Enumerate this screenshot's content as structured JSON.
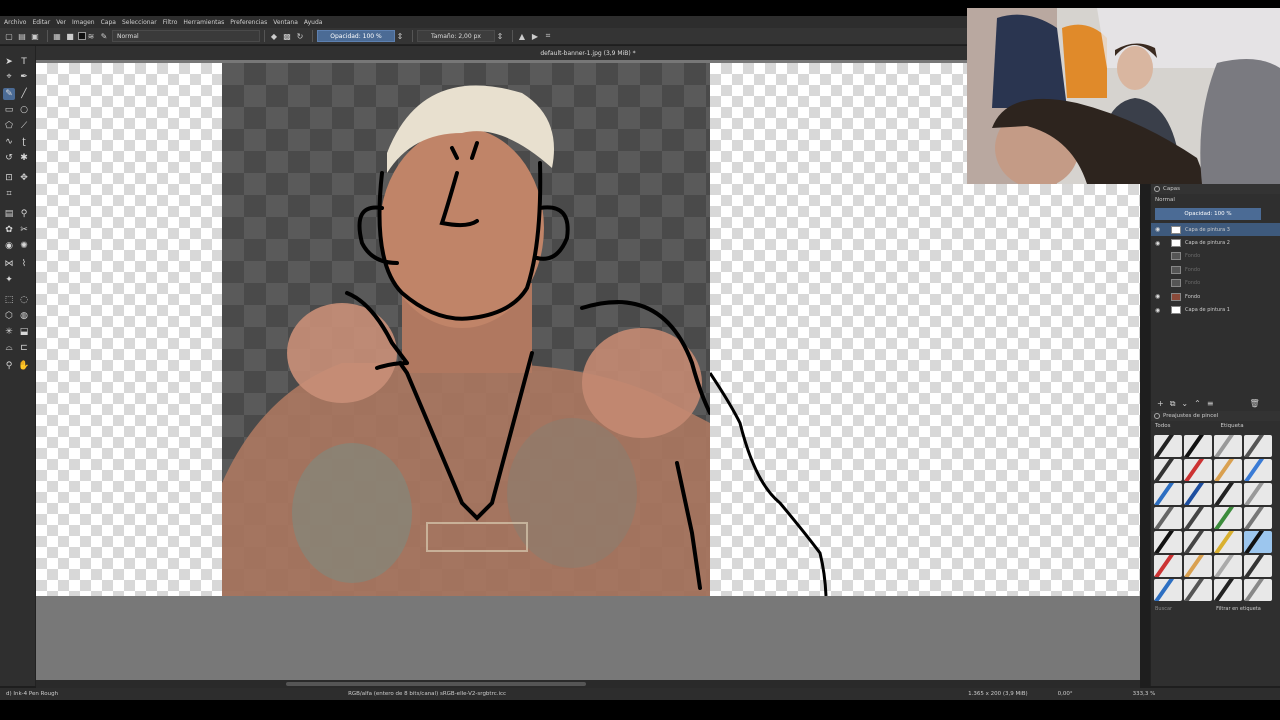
{
  "menubar": {
    "items": [
      "Archivo",
      "Editar",
      "Ver",
      "Imagen",
      "Capa",
      "Seleccionar",
      "Filtro",
      "Herramientas",
      "Preferencias",
      "Ventana",
      "Ayuda"
    ]
  },
  "toolbar": {
    "blend_mode": "Normal",
    "opacity": "Opacidad: 100 %",
    "size": "Tamaño: 2,00 px"
  },
  "document": {
    "title": "default-banner-1.jpg (3,9 MiB) *"
  },
  "layers_panel": {
    "title": "Capas",
    "blend_mode": "Normal",
    "opacity": "Opacidad: 100 %",
    "layers": [
      {
        "name": "Capa de pintura 3",
        "visible": true,
        "selected": true
      },
      {
        "name": "Capa de pintura 2",
        "visible": true,
        "selected": false
      },
      {
        "name": "Fondo",
        "visible": false,
        "selected": false
      },
      {
        "name": "Fondo",
        "visible": false,
        "selected": false
      },
      {
        "name": "Fondo",
        "visible": false,
        "selected": false
      },
      {
        "name": "Fondo",
        "visible": true,
        "selected": false
      },
      {
        "name": "Capa de pintura 1",
        "visible": true,
        "selected": false
      }
    ]
  },
  "brush_panel": {
    "title": "Preajustes de pincel",
    "filter": "Todos",
    "tag": "Etiqueta",
    "search_placeholder": "Buscar",
    "filter_in_tag": "Filtrar en etiqueta"
  },
  "status": {
    "brush": "d) Ink-4 Pen Rough",
    "color_profile": "RGB/alfa (entero de 8 bits/canal)  sRGB-elle-V2-srgbtrc.icc",
    "image_size": "1.365 x 200 (3,9 MiB)",
    "rotation": "0,00°",
    "zoom": "333,3 %"
  },
  "colors": {
    "accent": "#4b6b95",
    "panel_bg": "#2f2f2f",
    "canvas_bg": "#777777"
  }
}
